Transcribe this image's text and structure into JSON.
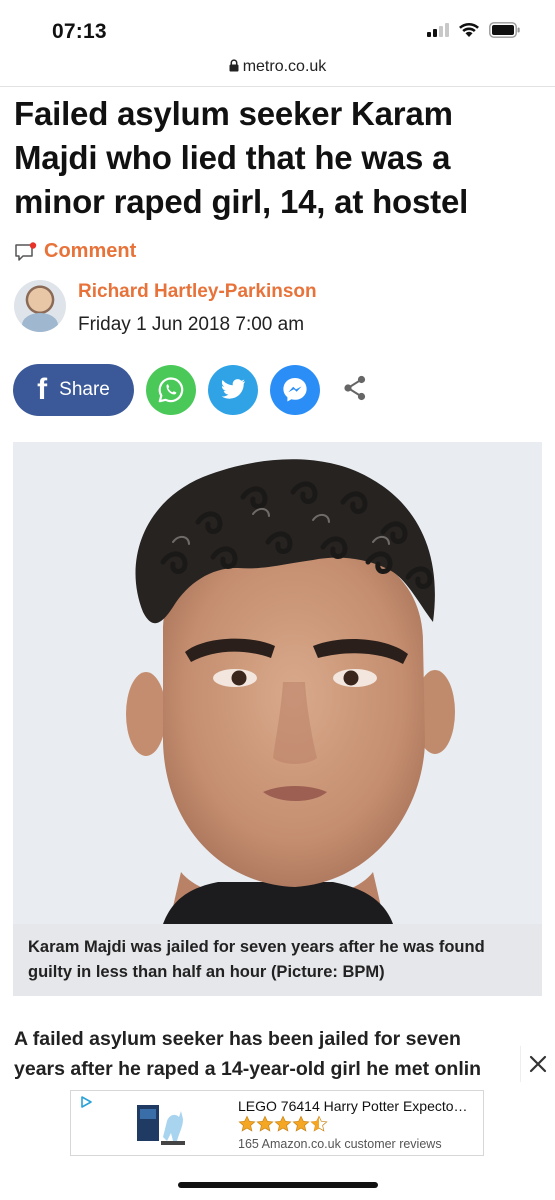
{
  "status_bar": {
    "time": "07:13",
    "icons": [
      "cellular-signal-icon",
      "wifi-icon",
      "battery-icon"
    ]
  },
  "browser": {
    "url": "metro.co.uk",
    "lock_icon": "lock-icon"
  },
  "article": {
    "headline": "Failed asylum seeker Karam Majdi who lied that he was a minor raped girl, 14, at hostel",
    "comment_label": "Comment",
    "author_name": "Richard Hartley-Parkinson",
    "published": "Friday 1 Jun 2018 7:00 am",
    "image_caption": "Karam Majdi was jailed for seven years after he was found guilty in less than half an hour (Picture: BPM)",
    "body_line_1": "A failed asylum seeker has been jailed for seven",
    "body_line_2": "years after he raped a 14-year-old girl he met onlin"
  },
  "share": {
    "facebook_label": "Share",
    "buttons": [
      "facebook-icon",
      "whatsapp-icon",
      "twitter-icon",
      "messenger-icon",
      "share-icon"
    ]
  },
  "ad": {
    "title": "LEGO 76414 Harry Potter Expecto…",
    "rating": 4.5,
    "rating_max": 5,
    "reviews": "165 Amazon.co.uk customer reviews"
  },
  "colors": {
    "accent": "#e8733a",
    "facebook": "#3b5998",
    "whatsapp": "#4ac959",
    "twitter": "#2fa3e6",
    "messenger": "#2b8ef7",
    "caption_bg": "#e6e7ea"
  }
}
